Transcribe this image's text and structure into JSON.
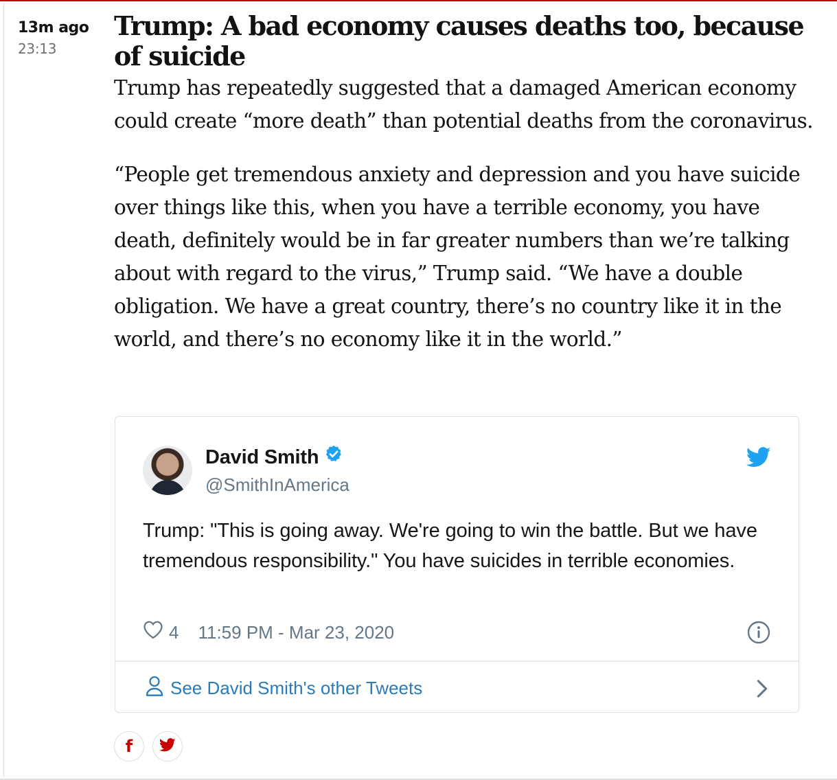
{
  "entry": {
    "time_ago": "13m ago",
    "time": "23:13",
    "headline": "Trump: A bad economy causes deaths too, because of suicide",
    "paragraphs": [
      "Trump has repeatedly suggested that a damaged American economy could create “more death” than potential deaths from the coronavirus.",
      "“People get tremendous anxiety and depression and you have suicide over things like this, when you have a terrible economy, you have death, definitely would be in far greater numbers than we’re talking about with regard to the virus,” Trump said. “We have a double obligation. We have a great country, there’s no country like it in the world, and there’s no economy like it in the world.”"
    ]
  },
  "tweet": {
    "author_name": "David Smith",
    "handle": "@SmithInAmerica",
    "text": "Trump: \"This is going away. We're going to win the battle. But we have tremendous responsibility.\" You have suicides in terrible economies.",
    "likes": "4",
    "timestamp": "11:59 PM - Mar 23, 2020",
    "see_more": "See David Smith's other Tweets",
    "icons": {
      "verified": "verified-badge-icon",
      "bird": "twitter-bird-icon",
      "like": "heart-icon",
      "info": "info-icon",
      "person": "person-icon",
      "chevron": "chevron-right-icon"
    },
    "colors": {
      "twitter_blue": "#1da1f2",
      "link": "#2b7bb9",
      "muted": "#657786"
    }
  },
  "share": {
    "icons": [
      "facebook-icon",
      "twitter-icon"
    ],
    "color": "#c70000"
  }
}
